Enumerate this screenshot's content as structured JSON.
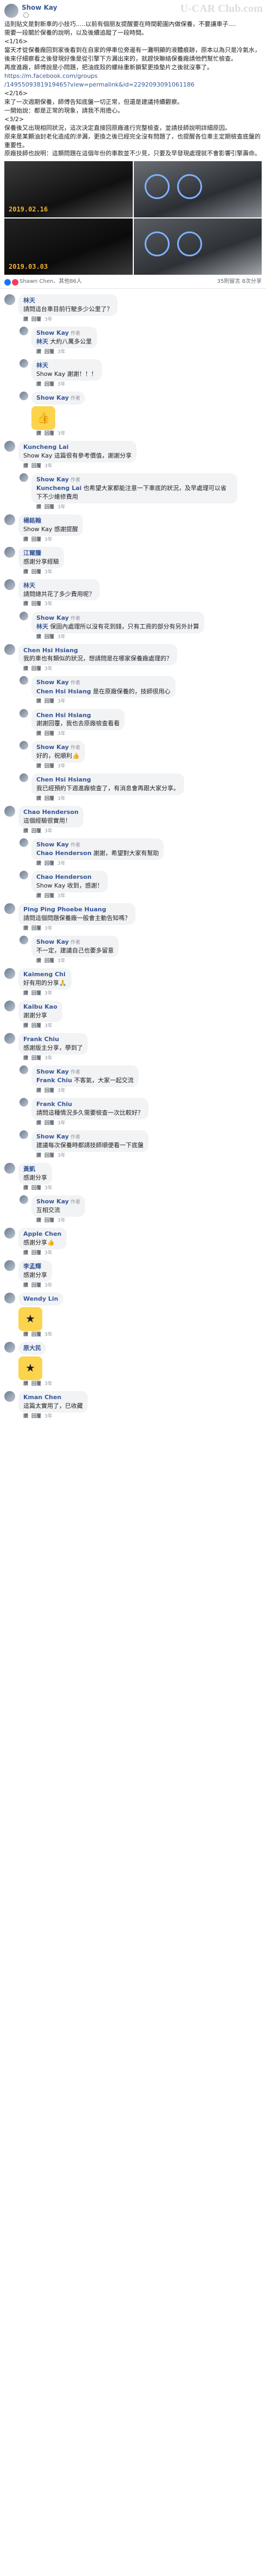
{
  "watermark": "U-CAR Club.com",
  "post": {
    "author": "Show Kay",
    "meta": "",
    "lines": [
      "這則貼文是對新車的小技巧.....以前有個朋友提醒要在時間範圍內做保養，不要讓車子....",
      "需要一段關於保養的說明，以及後續追蹤了一段時間。",
      "<1/16>",
      "當天才從保養廠回到家後看到在自家的停車位旁邊有一灘明顯的液體痕跡，原本以為只是冷氣水，後來仔細察看之後發現好像是從引擎下方漏出來的，就趕快聯絡保養廠請他們幫忙檢查。",
      "再度進廠，師傅說是小問題，把油底殼的螺絲重新鎖緊更換墊片之後就沒事了。",
      "https://m.facebook.com/groups",
      "/1495509381919465?view=permalink&id=2292093091061186",
      "<2/16>",
      "來了一次週期保養，師傅告知底盤一切正常，但還是建議持續觀察。",
      "一開始說：都是正常的現象，請我不用擔心。",
      "<3/2>",
      "保養後又出現相同狀況，這次決定直接回原廠進行完整檢查，並請技師說明詳細原因。",
      "原來是某顆油封老化造成的滲漏，更換之後已經完全沒有問題了，也提醒各位車主定期檢查底盤的重要性。",
      "原廠技師也說明：這類問題在這個年份的車款並不少見，只要及早發現處理就不會影響引擎壽命。"
    ],
    "photos": [
      {
        "date": "2019.02.16"
      },
      {
        "date": ""
      },
      {
        "date": "2019.03.03"
      },
      {
        "date": ""
      }
    ],
    "reactions": {
      "names": "Shawn Chen、其他86人",
      "stats": "35則留言 8次分享"
    }
  },
  "comments": [
    {
      "name": "林天",
      "badge": "",
      "reply": false,
      "text": "請問這台車目前行駛多少公里了？",
      "time": "3年",
      "sticker": ""
    },
    {
      "name": "Show Kay",
      "badge": "作者",
      "reply": true,
      "mention": "林天",
      "text": "大約八萬多公里",
      "time": "3年",
      "sticker": ""
    },
    {
      "name": "林天",
      "badge": "",
      "reply": true,
      "text": "Show Kay 謝謝！！！",
      "time": "3年",
      "sticker": ""
    },
    {
      "name": "Show Kay",
      "badge": "作者",
      "reply": true,
      "text": "",
      "time": "3年",
      "sticker": "like"
    },
    {
      "name": "Kuncheng Lai",
      "badge": "",
      "reply": false,
      "text": "Show Kay 這篇很有參考價值，謝謝分享",
      "time": "3年",
      "sticker": ""
    },
    {
      "name": "Show Kay",
      "badge": "作者",
      "reply": true,
      "mention": "Kuncheng Lai",
      "text": "也希望大家都能注意一下車底的狀況，及早處理可以省下不少維修費用",
      "time": "3年",
      "sticker": ""
    },
    {
      "name": "楊銘翰",
      "badge": "",
      "reply": false,
      "text": "Show Kay 感謝提醒",
      "time": "3年",
      "sticker": ""
    },
    {
      "name": "江爾騰",
      "badge": "",
      "reply": false,
      "text": "感謝分享經驗",
      "time": "3年",
      "sticker": ""
    },
    {
      "name": "林天",
      "badge": "",
      "reply": false,
      "text": "請問總共花了多少費用呢？",
      "time": "3年",
      "sticker": ""
    },
    {
      "name": "Show Kay",
      "badge": "作者",
      "reply": true,
      "mention": "林天",
      "text": "保固內處理所以沒有花到錢，只有工資的部分有另外計算",
      "time": "3年",
      "sticker": ""
    },
    {
      "name": "Chen Hsi Hsiang",
      "badge": "",
      "reply": false,
      "text": "我的車也有類似的狀況，想請問是在哪家保養廠處理的？",
      "time": "3年",
      "sticker": ""
    },
    {
      "name": "Show Kay",
      "badge": "作者",
      "reply": true,
      "mention": "Chen Hsi Hsiang",
      "text": "是在原廠保養的，技師很用心",
      "time": "3年",
      "sticker": ""
    },
    {
      "name": "Chen Hsi Hsiang",
      "badge": "",
      "reply": true,
      "text": "謝謝回覆，我也去原廠檢查看看",
      "time": "3年",
      "sticker": ""
    },
    {
      "name": "Show Kay",
      "badge": "作者",
      "reply": true,
      "text": "好的，祝順利👍",
      "time": "3年",
      "sticker": ""
    },
    {
      "name": "Chen Hsi Hsiang",
      "badge": "",
      "reply": true,
      "text": "我已經預約下週進廠檢查了，有消息會再跟大家分享。",
      "time": "3年",
      "sticker": ""
    },
    {
      "name": "Chao Henderson",
      "badge": "",
      "reply": false,
      "text": "這個經驗很實用！",
      "time": "3年",
      "sticker": ""
    },
    {
      "name": "Show Kay",
      "badge": "作者",
      "reply": true,
      "mention": "Chao Henderson",
      "text": "謝謝，希望對大家有幫助",
      "time": "3年",
      "sticker": ""
    },
    {
      "name": "Chao Henderson",
      "badge": "",
      "reply": true,
      "text": "Show Kay 收到，感謝！",
      "time": "3年",
      "sticker": ""
    },
    {
      "name": "Ping Ping Phoebe Huang",
      "badge": "",
      "reply": false,
      "text": "請問這個問題保養廠一般會主動告知嗎？",
      "time": "3年",
      "sticker": ""
    },
    {
      "name": "Show Kay",
      "badge": "作者",
      "reply": true,
      "text": "不一定，建議自己也要多留意",
      "time": "3年",
      "sticker": ""
    },
    {
      "name": "Kaimeng Chi",
      "badge": "",
      "reply": false,
      "text": "好有用的分享🙏",
      "time": "3年",
      "sticker": ""
    },
    {
      "name": "Kaibu Kao",
      "badge": "",
      "reply": false,
      "text": "謝謝分享",
      "time": "3年",
      "sticker": ""
    },
    {
      "name": "Frank Chiu",
      "badge": "",
      "reply": false,
      "text": "感謝版主分享，學到了",
      "time": "3年",
      "sticker": ""
    },
    {
      "name": "Show Kay",
      "badge": "作者",
      "reply": true,
      "mention": "Frank Chiu",
      "text": "不客氣，大家一起交流",
      "time": "3年",
      "sticker": ""
    },
    {
      "name": "Frank Chiu",
      "badge": "",
      "reply": true,
      "text": "請問這種情況多久需要檢查一次比較好？",
      "time": "3年",
      "sticker": ""
    },
    {
      "name": "Show Kay",
      "badge": "作者",
      "reply": true,
      "text": "建議每次保養時都請技師順便看一下底盤",
      "time": "3年",
      "sticker": ""
    },
    {
      "name": "黃凱",
      "badge": "",
      "reply": false,
      "text": "感謝分享",
      "time": "3年",
      "sticker": ""
    },
    {
      "name": "Show Kay",
      "badge": "作者",
      "reply": true,
      "text": "互相交流",
      "time": "3年",
      "sticker": ""
    },
    {
      "name": "Apple Chen",
      "badge": "",
      "reply": false,
      "text": "感謝分享👍",
      "time": "3年",
      "sticker": ""
    },
    {
      "name": "李孟輝",
      "badge": "",
      "reply": false,
      "text": "感謝分享",
      "time": "3年",
      "sticker": ""
    },
    {
      "name": "Wendy Lin",
      "badge": "",
      "reply": false,
      "text": "",
      "time": "3年",
      "sticker": "sticker"
    },
    {
      "name": "原大民",
      "badge": "",
      "reply": false,
      "text": "",
      "time": "3年",
      "sticker": "sticker"
    },
    {
      "name": "Kman Chen",
      "badge": "",
      "reply": false,
      "text": "這篇太實用了，已收藏",
      "time": "3年",
      "sticker": ""
    }
  ],
  "labels": {
    "like": "讚",
    "reply": "回覆"
  }
}
